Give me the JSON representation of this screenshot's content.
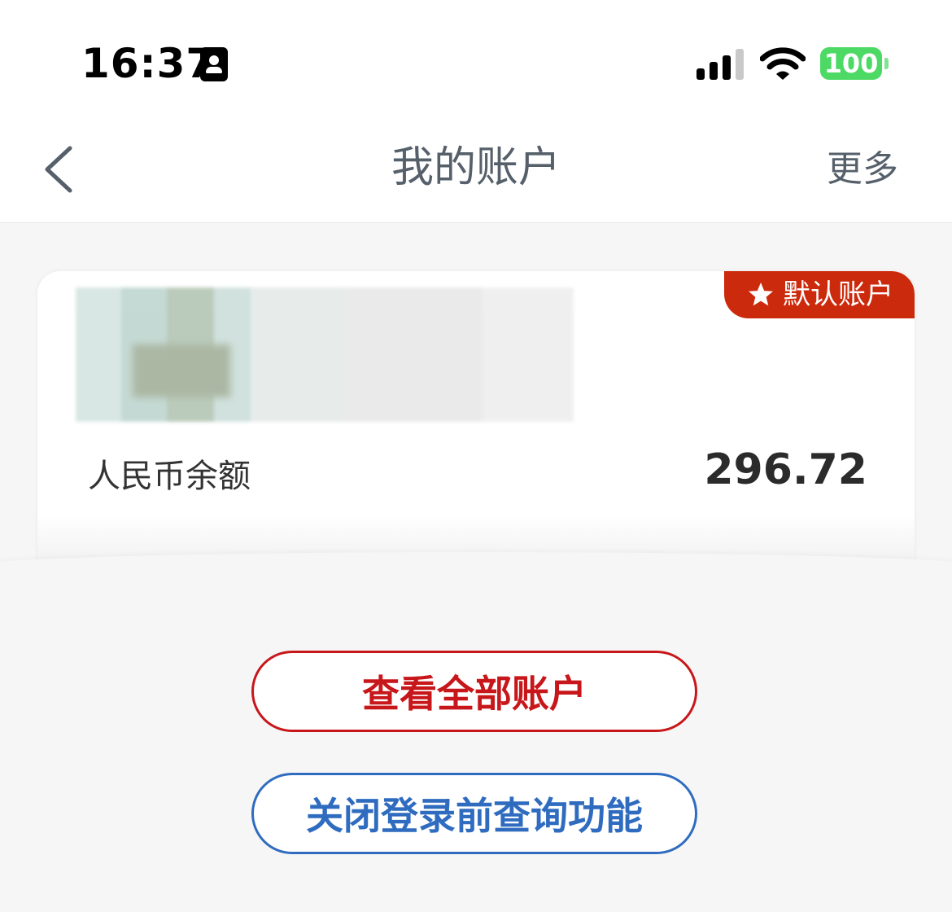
{
  "status_bar": {
    "time": "16:37",
    "battery": "100",
    "icons": [
      "id-badge-icon",
      "signal-icon",
      "wifi-icon",
      "battery-icon"
    ]
  },
  "nav": {
    "back_icon": "chevron-left-icon",
    "title": "我的账户",
    "more": "更多"
  },
  "account_card": {
    "default_badge": "默认账户",
    "badge_icon": "star-icon",
    "balance_label": "人民币余额",
    "balance_value": "296.72"
  },
  "actions": {
    "view_all": "查看全部账户",
    "close_query": "关闭登录前查询功能"
  },
  "colors": {
    "accent_red": "#c8171a",
    "badge_red": "#cc2a0c",
    "accent_blue": "#2f6cc0",
    "battery_green": "#4cd964",
    "nav_text": "#56606b"
  }
}
